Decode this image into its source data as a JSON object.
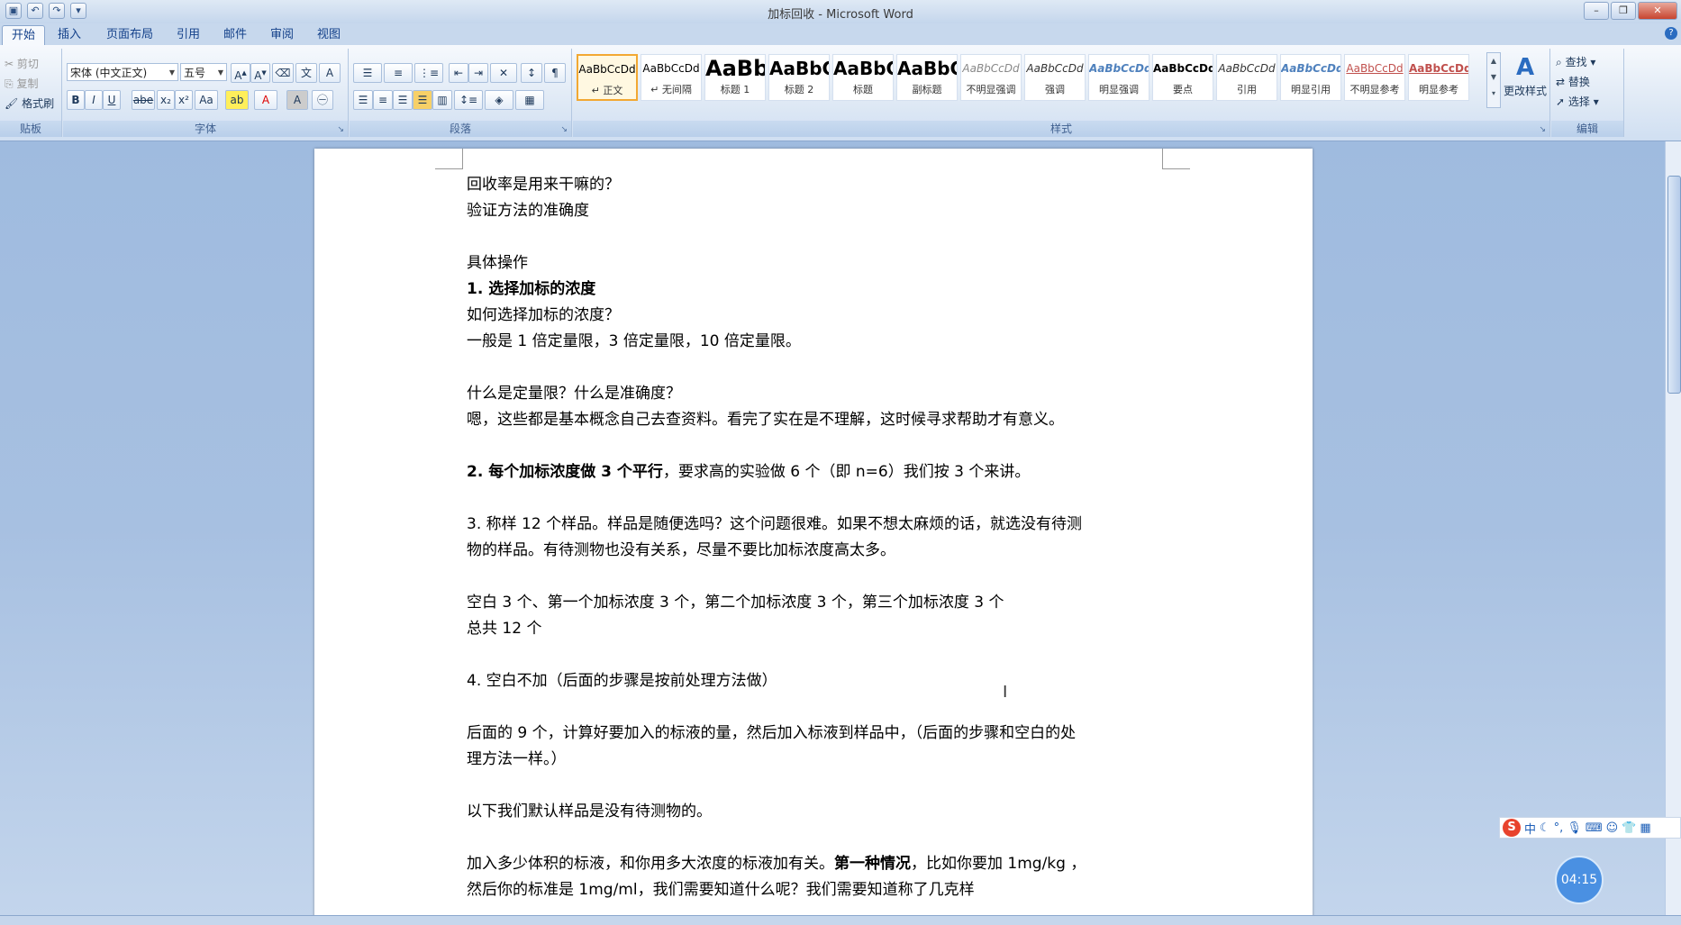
{
  "window": {
    "title": "加标回收 - Microsoft Word"
  },
  "tabs": [
    "开始",
    "插入",
    "页面布局",
    "引用",
    "邮件",
    "审阅",
    "视图"
  ],
  "clipboard": {
    "cut": "剪切",
    "copy": "复制",
    "format_painter": "格式刷",
    "group_label": "贴板"
  },
  "font": {
    "name": "宋体 (中文正文)",
    "size": "五号",
    "group_label": "字体"
  },
  "paragraph": {
    "group_label": "段落"
  },
  "styles": {
    "group_label": "样式",
    "change_styles": "更改样式",
    "items": [
      {
        "sample": "AaBbCcDd",
        "name": "↵ 正文"
      },
      {
        "sample": "AaBbCcDd",
        "name": "↵ 无间隔"
      },
      {
        "sample": "AaBb",
        "name": "标题 1"
      },
      {
        "sample": "AaBbC",
        "name": "标题 2"
      },
      {
        "sample": "AaBbC",
        "name": "标题"
      },
      {
        "sample": "AaBbC",
        "name": "副标题"
      },
      {
        "sample": "AaBbCcDd",
        "name": "不明显强调"
      },
      {
        "sample": "AaBbCcDd",
        "name": "强调"
      },
      {
        "sample": "AaBbCcDd",
        "name": "明显强调"
      },
      {
        "sample": "AaBbCcDd",
        "name": "要点"
      },
      {
        "sample": "AaBbCcDd",
        "name": "引用"
      },
      {
        "sample": "AaBbCcDd",
        "name": "明显引用"
      },
      {
        "sample": "AaBbCcDd",
        "name": "不明显参考"
      },
      {
        "sample": "AaBbCcDd",
        "name": "明显参考"
      }
    ]
  },
  "editing": {
    "find": "查找",
    "replace": "替换",
    "select": "选择",
    "group_label": "编辑"
  },
  "document": {
    "l01": "回收率是用来干嘛的？",
    "l02": "验证方法的准确度",
    "l03": "具体操作",
    "l04": "1. 选择加标的浓度",
    "l05": "如何选择加标的浓度？",
    "l06": "一般是 1 倍定量限，3 倍定量限，10 倍定量限。",
    "l07": "什么是定量限？什么是准确度？",
    "l08": "嗯，这些都是基本概念自己去查资料。看完了实在是不理解，这时候寻求帮助才有意义。",
    "l09a": "2. 每个加标浓度做 3 个平行",
    "l09b": "，要求高的实验做 6 个（即 n=6）我们按 3 个来讲。",
    "l10": "3. 称样 12 个样品。样品是随便选吗？这个问题很难。如果不想太麻烦的话，就选没有待测",
    "l11": "物的样品。有待测物也没有关系，尽量不要比加标浓度高太多。",
    "l12": "空白 3 个、第一个加标浓度 3 个，第二个加标浓度 3 个，第三个加标浓度 3 个",
    "l13": "总共 12 个",
    "l14": "4. 空白不加（后面的步骤是按前处理方法做）",
    "l15": "后面的 9 个，计算好要加入的标液的量，然后加入标液到样品中，（后面的步骤和空白的处",
    "l16": "理方法一样。）",
    "l17": "以下我们默认样品是没有待测物的。",
    "l18a": "加入多少体积的标液，和你用多大浓度的标液加有关。",
    "l18b": "第一种情况",
    "l18c": "，比如你要加 1mg/kg ，",
    "l19": "然后你的标准是 1mg/ml，我们需要知道什么呢？我们需要知道称了几克样"
  },
  "ime": {
    "lang": "中"
  },
  "timer": "04:15"
}
